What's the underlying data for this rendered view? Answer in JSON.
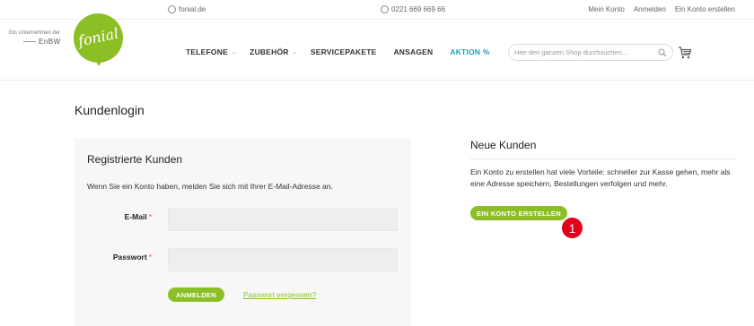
{
  "topbar": {
    "website": "fonial.de",
    "phone": "0221 669 669 66",
    "links": [
      "Mein Konto",
      "Anmelden",
      "Ein Konto erstellen"
    ]
  },
  "header": {
    "enbw_line1": "Ein Unternehmen der",
    "enbw_line2": "EnBW",
    "logo_text": "fonial",
    "nav": [
      {
        "label": "TELEFONE",
        "chevron": true
      },
      {
        "label": "ZUBEHÖR",
        "chevron": true
      },
      {
        "label": "SERVICEPAKETE",
        "chevron": false
      },
      {
        "label": "ANSAGEN",
        "chevron": false
      },
      {
        "label": "AKTION %",
        "chevron": false
      }
    ],
    "search_placeholder": "Hier den ganzen Shop durchsuchen..."
  },
  "page": {
    "title": "Kundenlogin"
  },
  "registered": {
    "heading": "Registrierte Kunden",
    "intro": "Wenn Sie ein Konto haben, melden Sie sich mit Ihrer E-Mail-Adresse an.",
    "email_label": "E-Mail",
    "password_label": "Passwort",
    "required_mark": "*",
    "login_button": "ANMELDEN",
    "forgot_link": "Passwort vergessen?"
  },
  "new_customers": {
    "heading": "Neue Kunden",
    "text": "Ein Konto zu erstellen hat viele Vorteile: schneller zur Kasse gehen, mehr als eine Adresse speichern, Bestellungen verfolgen und mehr.",
    "create_button": "EIN KONTO ERSTELLEN"
  },
  "annotation": {
    "marker": "1"
  },
  "colors": {
    "brand_green": "#8cbf26",
    "aktion_teal": "#1a9fb4",
    "marker_red": "#e2001a"
  }
}
